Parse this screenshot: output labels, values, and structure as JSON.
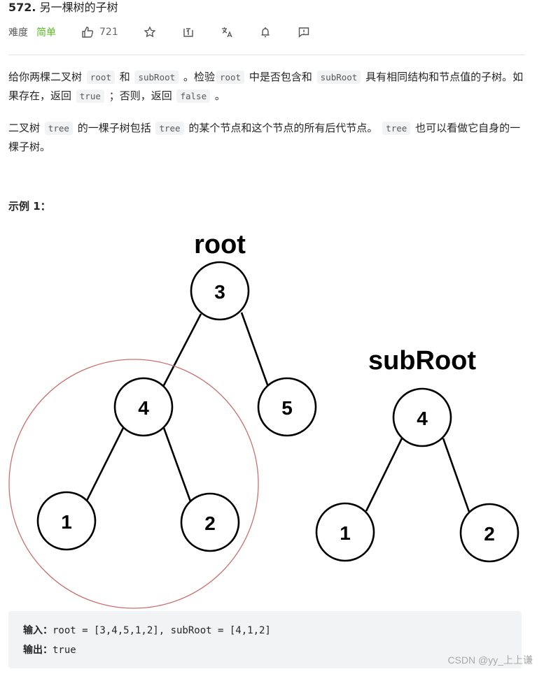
{
  "header": {
    "problem_number": "572.",
    "problem_title": "另一棵树的子树",
    "difficulty_label": "难度",
    "difficulty": "简单",
    "difficulty_color": "#5ab726",
    "likes": "721",
    "icons": [
      "thumbs-up-icon",
      "star-icon",
      "share-icon",
      "translate-icon",
      "bell-icon",
      "feedback-icon"
    ]
  },
  "description": {
    "p1": {
      "t1": "给你两棵二叉树",
      "c1": "root",
      "t2": "和",
      "c2": "subRoot",
      "t3": "。检验",
      "c3": "root",
      "t4": "中是否包含和",
      "c4": "subRoot",
      "t5": "具有相同结构和节点值的子树。如果存在，返回",
      "c5": "true",
      "t6": "；否则，返回",
      "c6": "false",
      "t7": "。"
    },
    "p2": {
      "t1": "二叉树",
      "c1": "tree",
      "t2": "的一棵子树包括",
      "c2": "tree",
      "t3": "的某个节点和这个节点的所有后代节点。",
      "c3": "tree",
      "t4": "也可以看做它自身的一棵子树。"
    }
  },
  "example": {
    "title": "示例 1：",
    "diagram": {
      "root_label": "root",
      "subroot_label": "subRoot",
      "root_nodes": [
        "3",
        "4",
        "5",
        "1",
        "2"
      ],
      "subroot_nodes": [
        "4",
        "1",
        "2"
      ],
      "highlight_color": "#c9706f"
    },
    "input_label": "输入：",
    "input_value": "root = [3,4,5,1,2], subRoot = [4,1,2]",
    "output_label": "输出：",
    "output_value": "true"
  },
  "watermark": "CSDN @yy_上上谦"
}
